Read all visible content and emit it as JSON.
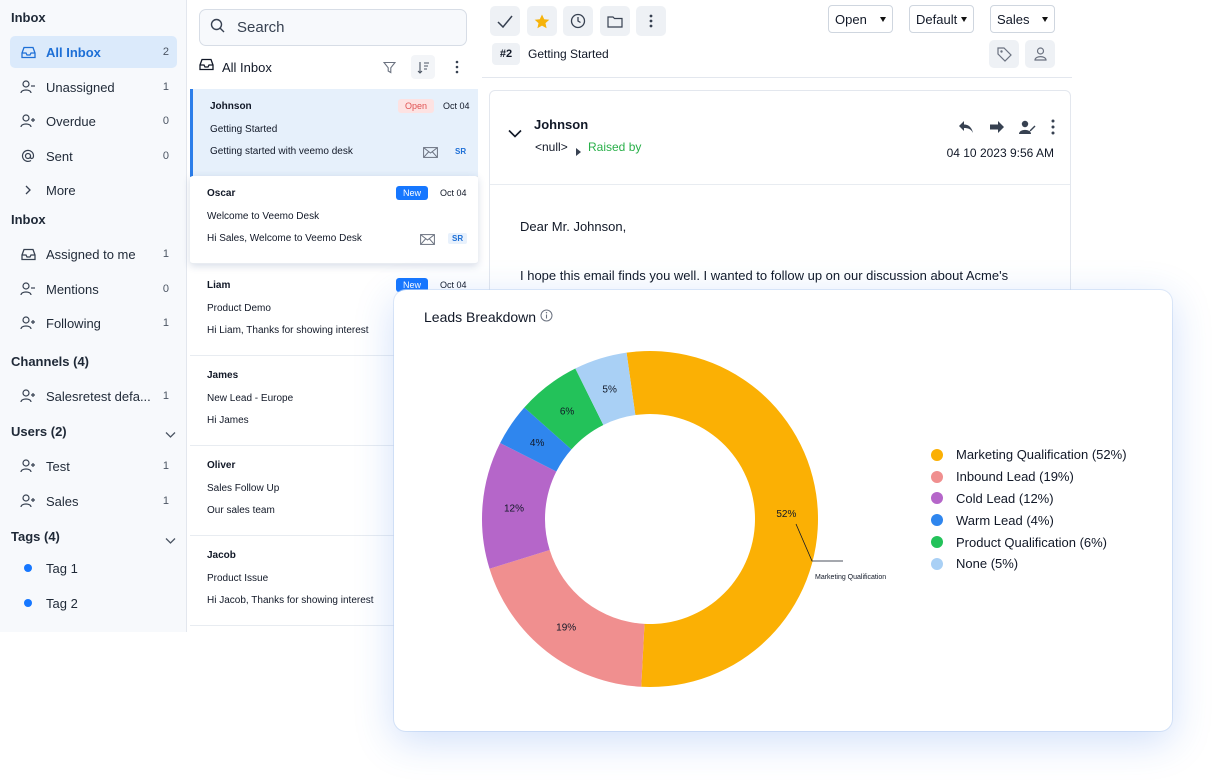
{
  "sidebar": {
    "inbox_title": "Inbox",
    "top_items": [
      {
        "label": "All Inbox",
        "count": "2"
      },
      {
        "label": "Unassigned",
        "count": "1"
      },
      {
        "label": "Overdue",
        "count": "0"
      },
      {
        "label": "Sent",
        "count": "0"
      },
      {
        "label": "More",
        "count": ""
      }
    ],
    "inbox2_title": "Inbox",
    "inbox_items": [
      {
        "label": "Assigned to me",
        "count": "1"
      },
      {
        "label": "Mentions",
        "count": "0"
      },
      {
        "label": "Following",
        "count": "1"
      }
    ],
    "channels_title": "Channels (4)",
    "channel_items": [
      {
        "label": "Salesretest defa...",
        "count": "1"
      }
    ],
    "users_title": "Users (2)",
    "user_items": [
      {
        "label": "Test",
        "count": "1"
      },
      {
        "label": "Sales",
        "count": "1"
      }
    ],
    "tags_title": "Tags (4)",
    "tag_items": [
      {
        "label": "Tag 1",
        "color": "#1677ff"
      },
      {
        "label": "Tag 2",
        "color": "#1677ff"
      }
    ]
  },
  "list": {
    "search_placeholder": "Search",
    "header_title": "All Inbox",
    "cards": [
      {
        "name": "Johnson",
        "badge": "Open",
        "date": "Oct 04",
        "subject": "Getting Started",
        "preview": "Getting started with veemo desk",
        "initials": "SR"
      },
      {
        "name": "Oscar",
        "badge": "New",
        "date": "Oct 04",
        "subject": "Welcome to Veemo Desk",
        "preview": "Hi Sales, Welcome to Veemo Desk",
        "initials": "SR"
      },
      {
        "name": "Liam",
        "badge": "New",
        "date": "Oct 04",
        "subject": "Product Demo",
        "preview": "Hi Liam, Thanks for showing interest"
      },
      {
        "name": "James",
        "subject": "New Lead - Europe",
        "preview": "Hi James"
      },
      {
        "name": "Oliver",
        "subject": "Sales Follow Up",
        "preview": "Our sales team"
      },
      {
        "name": "Jacob",
        "subject": "Product Issue",
        "preview": "Hi Jacob, Thanks for showing interest"
      }
    ]
  },
  "ticket": {
    "status_select": "Open",
    "priority_select": "Default",
    "team_select": "Sales",
    "id": "#2",
    "subject": "Getting Started"
  },
  "message": {
    "from": "Johnson",
    "email": "<null>",
    "raised_by": "Raised by",
    "timestamp": "04 10 2023 9:56 AM",
    "greeting": "Dear Mr. Johnson,",
    "body": "I hope this email finds you well. I wanted to follow up on our discussion about Acme's"
  },
  "chart_panel": {
    "title": "Leads Breakdown",
    "callout": "Marketing Qualification"
  },
  "chart_data": {
    "type": "pie",
    "title": "Leads Breakdown",
    "donut": true,
    "labels": [
      "Marketing Qualification",
      "Inbound Lead",
      "Cold Lead",
      "Warm Lead",
      "Product Qualification",
      "None"
    ],
    "values": [
      52,
      19,
      12,
      4,
      6,
      5
    ],
    "slice_labels": [
      "52%",
      "19%",
      "12%",
      "4%",
      "6%",
      "5%"
    ],
    "legend_labels": [
      "Marketing Qualification (52%)",
      "Inbound Lead (19%)",
      "Cold Lead (12%)",
      "Warm Lead (4%)",
      "Product Qualification (6%)",
      "None (5%)"
    ],
    "colors": [
      "#fbb004",
      "#f08f8f",
      "#b566c9",
      "#2f86ee",
      "#23c25a",
      "#a9d0f5"
    ],
    "legend_position": "right"
  }
}
